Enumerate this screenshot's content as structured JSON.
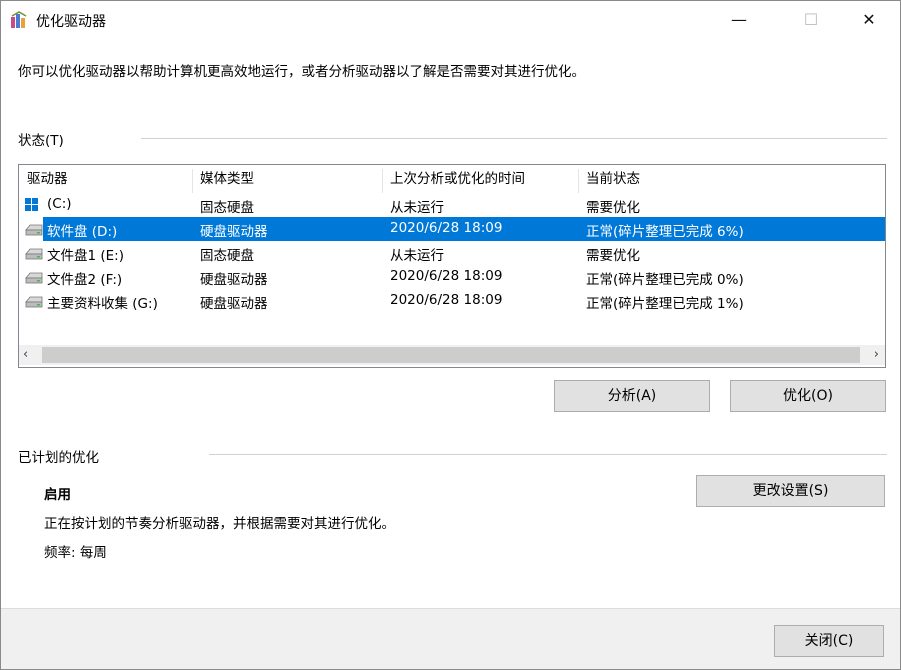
{
  "window": {
    "title": "优化驱动器",
    "minimize_glyph": "—",
    "maximize_glyph": "☐",
    "close_glyph": "✕"
  },
  "intro_text": "你可以优化驱动器以帮助计算机更高效地运行，或者分析驱动器以了解是否需要对其进行优化。",
  "status": {
    "label": "状态(T)",
    "columns": [
      "驱动器",
      "媒体类型",
      "上次分析或优化的时间",
      "当前状态"
    ],
    "rows": [
      {
        "drive": "(C:)",
        "media": "固态硬盘",
        "last_run": "从未运行",
        "state": "需要优化",
        "icon": "system-drive-icon",
        "selected": false
      },
      {
        "drive": "软件盘 (D:)",
        "media": "硬盘驱动器",
        "last_run": "2020/6/28 18:09",
        "state": "正常(碎片整理已完成 6%)",
        "icon": "drive-icon",
        "selected": true
      },
      {
        "drive": "文件盘1 (E:)",
        "media": "固态硬盘",
        "last_run": "从未运行",
        "state": "需要优化",
        "icon": "drive-icon",
        "selected": false
      },
      {
        "drive": "文件盘2 (F:)",
        "media": "硬盘驱动器",
        "last_run": "2020/6/28 18:09",
        "state": "正常(碎片整理已完成 0%)",
        "icon": "drive-icon",
        "selected": false
      },
      {
        "drive": "主要资料收集 (G:)",
        "media": "硬盘驱动器",
        "last_run": "2020/6/28 18:09",
        "state": "正常(碎片整理已完成 1%)",
        "icon": "drive-icon",
        "selected": false
      }
    ],
    "scroll_left": "‹",
    "scroll_right": "›"
  },
  "buttons": {
    "analyze": "分析(A)",
    "optimize": "优化(O)",
    "change_settings": "更改设置(S)",
    "close": "关闭(C)"
  },
  "scheduled": {
    "label": "已计划的优化",
    "state": "启用",
    "description": "正在按计划的节奏分析驱动器，并根据需要对其进行优化。",
    "frequency": "频率: 每周"
  },
  "colors": {
    "selection": "#0078d7",
    "footer_bg": "#f0f0f0"
  }
}
